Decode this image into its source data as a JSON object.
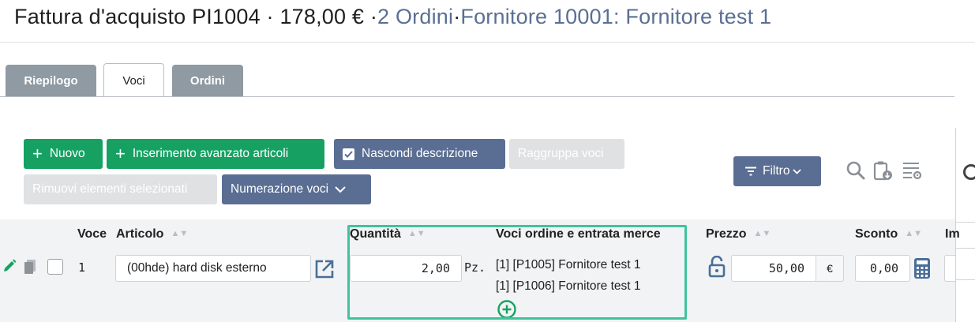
{
  "header": {
    "title": "Fattura d'acquisto PI1004 · 178,00 € ·",
    "orders_link": "2 Ordini",
    "separator": "·",
    "supplier_link": "Fornitore 10001: Fornitore test 1"
  },
  "tabs": [
    {
      "label": "Riepilogo",
      "active": false
    },
    {
      "label": "Voci",
      "active": true
    },
    {
      "label": "Ordini",
      "active": false
    }
  ],
  "toolbar": {
    "new_label": "Nuovo",
    "advanced_insert_label": "Inserimento avanzato articoli",
    "hide_description_label": "Nascondi descrizione",
    "group_items_label": "Raggruppa voci",
    "remove_selected_label": "Rimuovi elementi selezionati",
    "numbering_label": "Numerazione voci",
    "filter_label": "Filtro"
  },
  "table": {
    "columns": {
      "voce": "Voce",
      "articolo": "Articolo",
      "quantita": "Quantità",
      "voci_ordine": "Voci ordine e entrata merce",
      "prezzo": "Prezzo",
      "sconto": "Sconto",
      "importo_partial": "Im"
    },
    "rows": [
      {
        "voce": "1",
        "articolo": "(00hde) hard disk esterno",
        "quantita": "2,00",
        "unit": "Pz.",
        "order_lines": [
          "[1] [P1005] Fornitore test 1",
          "[1] [P1006] Fornitore test 1"
        ],
        "prezzo": "50,00",
        "currency": "€",
        "sconto": "0,00"
      }
    ]
  },
  "colors": {
    "primary_green": "#16a163",
    "primary_blue": "#5a6d93",
    "link": "#5a6f93",
    "highlight": "#3ec49c"
  }
}
